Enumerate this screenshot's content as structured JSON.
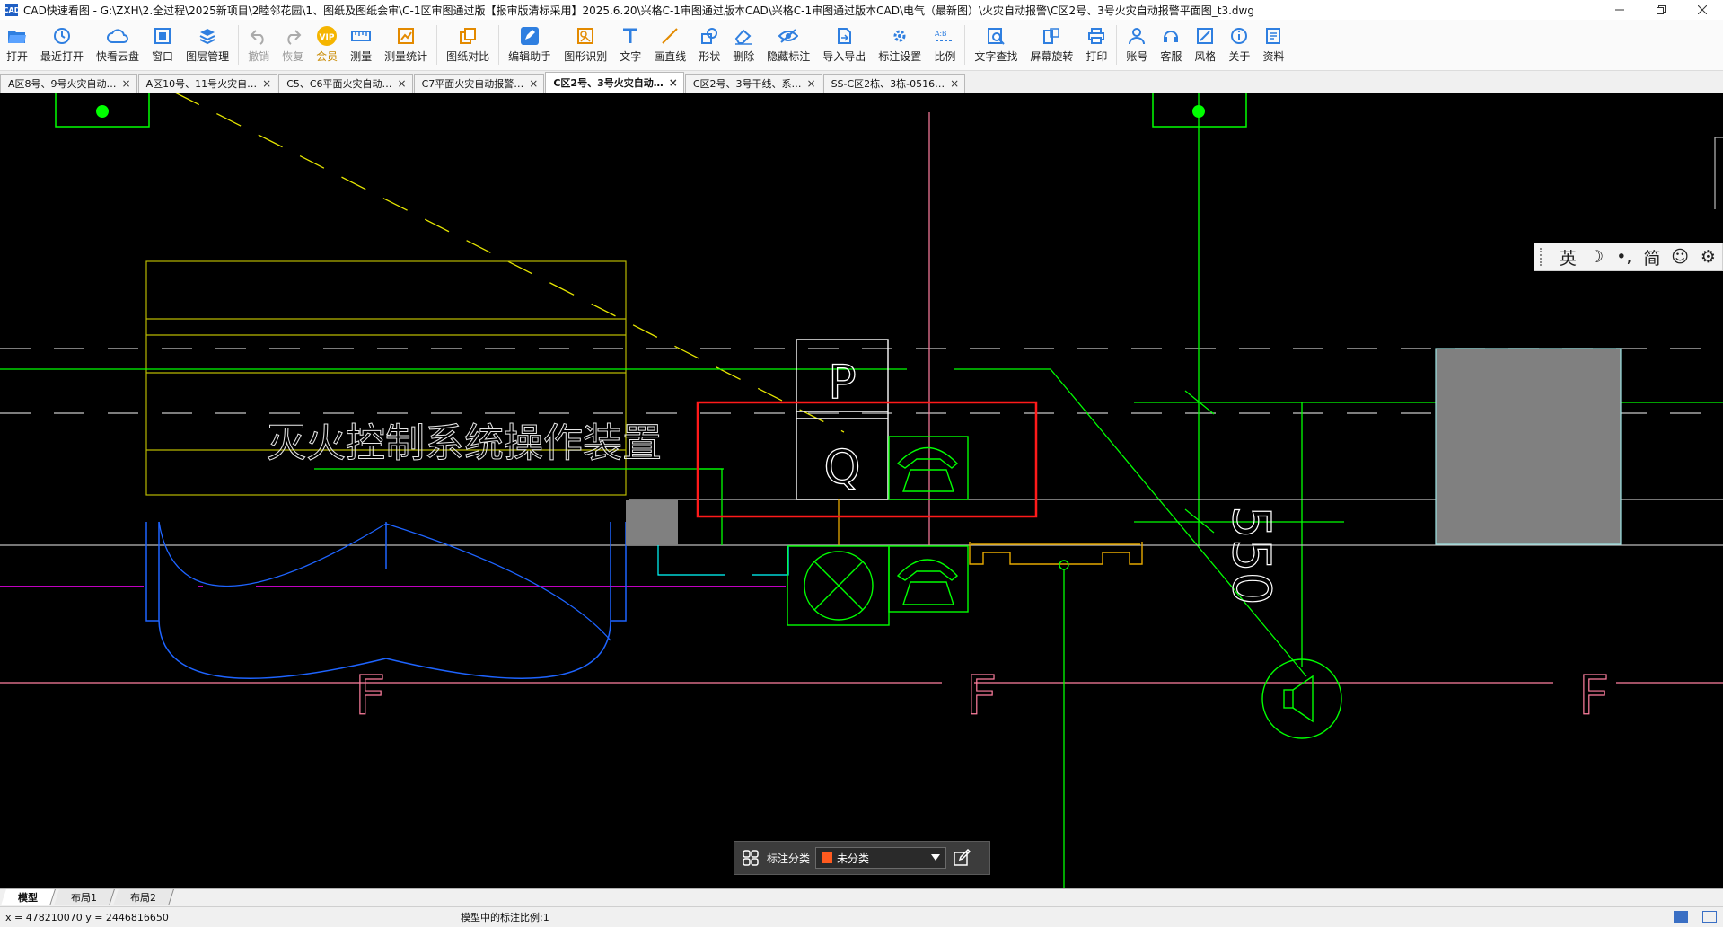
{
  "window": {
    "title": "CAD快速看图 - G:\\ZXH\\2.全过程\\2025新项目\\2睦邻花园\\1、图纸及图纸会审\\C-1区审图通过版【报审版清标采用】2025.6.20\\兴格C-1审图通过版本CAD\\兴格C-1审图通过版本CAD\\电气（最新图）\\火灾自动报警\\C区2号、3号火灾自动报警平面图_t3.dwg"
  },
  "toolbar": {
    "items": [
      {
        "label": "打开",
        "icon": "folder-open-icon"
      },
      {
        "label": "最近打开",
        "icon": "clock-icon"
      },
      {
        "label": "快看云盘",
        "icon": "cloud-icon"
      },
      {
        "label": "窗口",
        "icon": "window-icon"
      },
      {
        "label": "图层管理",
        "icon": "layers-icon"
      },
      {
        "label": "撤销",
        "icon": "undo-icon"
      },
      {
        "label": "恢复",
        "icon": "redo-icon"
      },
      {
        "label": "会员",
        "icon": "vip-icon"
      },
      {
        "label": "测量",
        "icon": "ruler-icon"
      },
      {
        "label": "测量统计",
        "icon": "measure-stats-icon"
      },
      {
        "label": "图纸对比",
        "icon": "compare-icon"
      },
      {
        "label": "编辑助手",
        "icon": "edit-assistant-icon"
      },
      {
        "label": "图形识别",
        "icon": "shape-recognize-icon"
      },
      {
        "label": "文字",
        "icon": "text-icon"
      },
      {
        "label": "画直线",
        "icon": "line-icon"
      },
      {
        "label": "形状",
        "icon": "shape-icon"
      },
      {
        "label": "删除",
        "icon": "eraser-icon"
      },
      {
        "label": "隐藏标注",
        "icon": "eye-hide-icon"
      },
      {
        "label": "导入导出",
        "icon": "import-export-icon"
      },
      {
        "label": "标注设置",
        "icon": "annotation-settings-icon"
      },
      {
        "label": "比例",
        "icon": "scale-icon"
      },
      {
        "label": "文字查找",
        "icon": "text-search-icon"
      },
      {
        "label": "屏幕旋转",
        "icon": "rotate-screen-icon"
      },
      {
        "label": "打印",
        "icon": "printer-icon"
      },
      {
        "label": "账号",
        "icon": "user-icon"
      },
      {
        "label": "客服",
        "icon": "headset-icon"
      },
      {
        "label": "风格",
        "icon": "style-icon"
      },
      {
        "label": "关于",
        "icon": "info-icon"
      },
      {
        "label": "资料",
        "icon": "documents-icon"
      }
    ]
  },
  "tabs": [
    {
      "label": "A区8号、9号火灾自动…",
      "active": false
    },
    {
      "label": "A区10号、11号火灾自…",
      "active": false
    },
    {
      "label": "C5、C6平面火灾自动…",
      "active": false
    },
    {
      "label": "C7平面火灾自动报警…",
      "active": false
    },
    {
      "label": "C区2号、3号火灾自动…",
      "active": true
    },
    {
      "label": "C区2号、3号干线、系…",
      "active": false
    },
    {
      "label": "SS-C区2栋、3栋-0516…",
      "active": false
    }
  ],
  "drawing": {
    "label_main": "灭火控制系统操作装置",
    "label_p": "P",
    "label_q": "Q",
    "label_550": "550",
    "label_f1": "F",
    "label_f2": "F",
    "label_f3": "F",
    "colors": {
      "yellow": "#ffff00",
      "green": "#00ff00",
      "red": "#ff0000",
      "magenta": "#ff00ff",
      "blue": "#1e64ff",
      "cyan": "#00ffff",
      "pink": "#ff7f9f",
      "white": "#ffffff",
      "gray": "#808080",
      "orange": "#e6a800"
    }
  },
  "ime": {
    "items": [
      "英",
      "☽",
      "•,",
      "简",
      "☺",
      "⚙"
    ]
  },
  "annotation_bar": {
    "label": "标注分类",
    "selected": "未分类",
    "swatch": "#ff5a1f"
  },
  "layout_tabs": [
    {
      "label": "模型",
      "active": true
    },
    {
      "label": "布局1",
      "active": false
    },
    {
      "label": "布局2",
      "active": false
    }
  ],
  "status": {
    "coords": "x = 478210070  y = 2446816650",
    "scale": "模型中的标注比例:1"
  }
}
